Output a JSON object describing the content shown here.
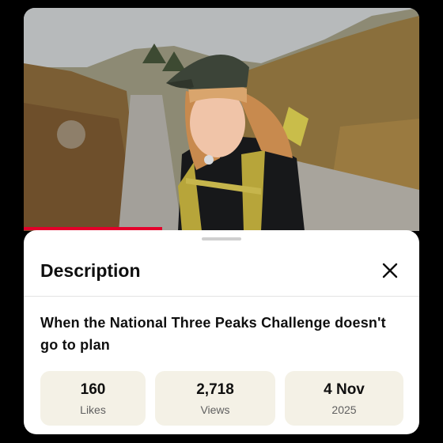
{
  "video": {
    "progress": 0.35
  },
  "description_panel": {
    "heading": "Description",
    "video_title": "When the National Three Peaks Challenge doesn't go to plan",
    "stats": [
      {
        "value": "160",
        "label": "Likes"
      },
      {
        "value": "2,718",
        "label": "Views"
      },
      {
        "value": "4 Nov",
        "label": "2025"
      }
    ]
  },
  "icons": {
    "close": "close-icon"
  }
}
